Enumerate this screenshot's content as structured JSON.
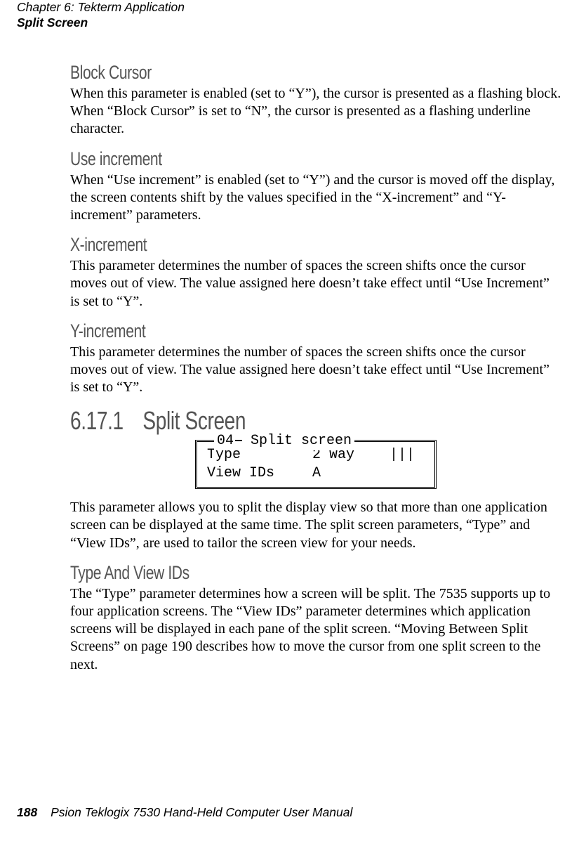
{
  "header": {
    "chapter": "Chapter 6: Tekterm Application",
    "section": "Split Screen"
  },
  "sections": {
    "block_cursor": {
      "title": "Block Cursor",
      "body": "When this parameter is enabled (set to “Y”), the cursor is presented as a flashing block. When “Block Cursor” is set to “N”, the cursor is presented as a flashing underline character."
    },
    "use_increment": {
      "title": "Use increment",
      "body": "When “Use increment” is enabled (set to “Y”) and the cursor is moved off the display, the screen contents shift by the values specified in the “X-increment” and “Y-increment” parameters."
    },
    "x_increment": {
      "title": "X-increment",
      "body": "This parameter determines the number of spaces the screen shifts once the cursor moves out of view. The value assigned here doesn’t take effect until “Use Increment” is set to “Y”."
    },
    "y_increment": {
      "title": "Y-increment",
      "body": "This parameter determines the number of spaces the screen shifts once the cursor moves out of view. The value assigned here doesn’t take effect until “Use Increment” is set to “Y”."
    },
    "split_screen": {
      "title": "6.17.1 Split Screen",
      "figure": {
        "legend_prefix": "04",
        "legend_text": " Split screen ",
        "rows": [
          {
            "label": "Type",
            "value": "2 Way",
            "suffix": "|||"
          },
          {
            "label": "View IDs",
            "value": "A",
            "suffix": ""
          }
        ]
      },
      "body": "This parameter allows you to split the display view so that more than one application screen can be displayed at the same time. The split screen parameters, “Type” and “View IDs”, are used to tailor the screen view for your needs."
    },
    "type_view_ids": {
      "title": "Type And View IDs",
      "body": "The “Type” parameter determines how a screen will be split. The 7535 supports up to four application screens. The “View IDs” parameter determines which application screens will be displayed in each pane of the split screen. “Moving Between Split Screens” on page 190 describes how to move the cursor from one split screen to the next."
    }
  },
  "footer": {
    "page_number": "188",
    "manual_title": "Psion Teklogix 7530 Hand-Held Computer User Manual"
  }
}
